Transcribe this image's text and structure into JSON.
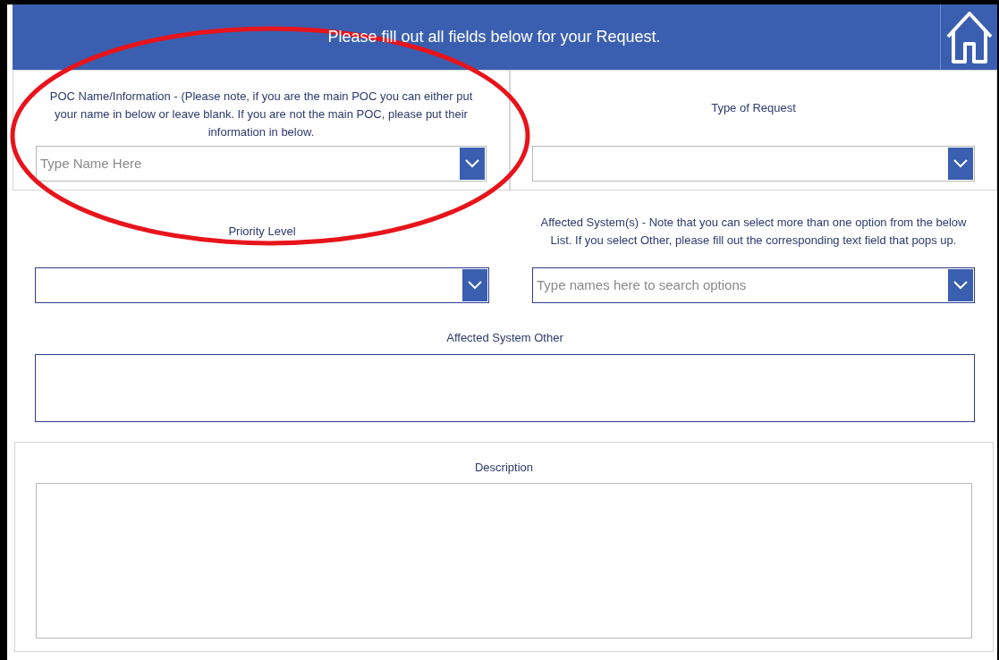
{
  "header": {
    "title": "Please fill out all fields below for your Request."
  },
  "fields": [
    {
      "kind": "dropdown",
      "label": "POC Name/Information - (Please note, if you are the main POC you can either put your name in below or leave blank. If you are not the main POC, please put their information in below.",
      "placeholder": "Type Name Here",
      "carded": true
    },
    {
      "kind": "dropdown",
      "label": "Type of Request",
      "carded": true
    },
    {
      "kind": "dropdown",
      "label": "Priority Level",
      "carded": false
    },
    {
      "kind": "dropdown",
      "label": "Affected System(s) - Note that you can select more than one option from the below List. If you select Other, please fill out the corresponding text field that pops up.",
      "placeholder": "Type names here to search options",
      "carded": false
    },
    {
      "kind": "textarea",
      "label": "Affected System Other",
      "carded": false
    },
    {
      "kind": "textarea",
      "label": "Description",
      "carded": true
    }
  ]
}
